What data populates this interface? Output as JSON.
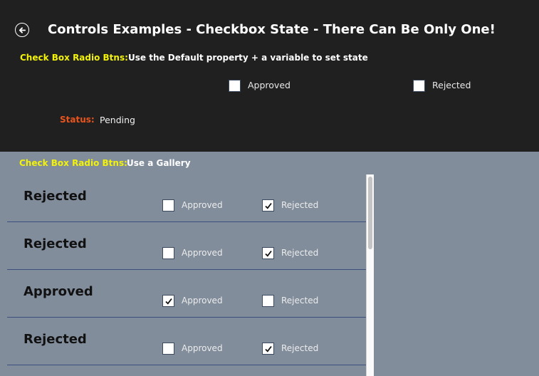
{
  "header": {
    "back_icon": "arrow-left-circle-icon",
    "title": "Controls Examples - Checkbox State - There Can Be Only One!"
  },
  "section1": {
    "label": "Check Box Radio Btns:",
    "description": "Use the Default property + a variable to set state",
    "checkboxes": [
      {
        "label": "Approved",
        "checked": false
      },
      {
        "label": "Rejected",
        "checked": false
      }
    ],
    "status_label": "Status:",
    "status_value": "Pending"
  },
  "section2": {
    "label": "Check Box Radio Btns:",
    "description": "Use a Gallery",
    "rows": [
      {
        "status": "Rejected",
        "approved_label": "Approved",
        "approved": false,
        "rejected_label": "Rejected",
        "rejected": true
      },
      {
        "status": "Rejected",
        "approved_label": "Approved",
        "approved": false,
        "rejected_label": "Rejected",
        "rejected": true
      },
      {
        "status": "Approved",
        "approved_label": "Approved",
        "approved": true,
        "rejected_label": "Rejected",
        "rejected": false
      },
      {
        "status": "Rejected",
        "approved_label": "Approved",
        "approved": false,
        "rejected_label": "Rejected",
        "rejected": true
      }
    ]
  },
  "colors": {
    "header_bg": "#202020",
    "gallery_bg": "#828d9c",
    "label_yellow": "#f2f20a",
    "status_orange": "#e8541e",
    "separator": "#3d4f7e"
  }
}
